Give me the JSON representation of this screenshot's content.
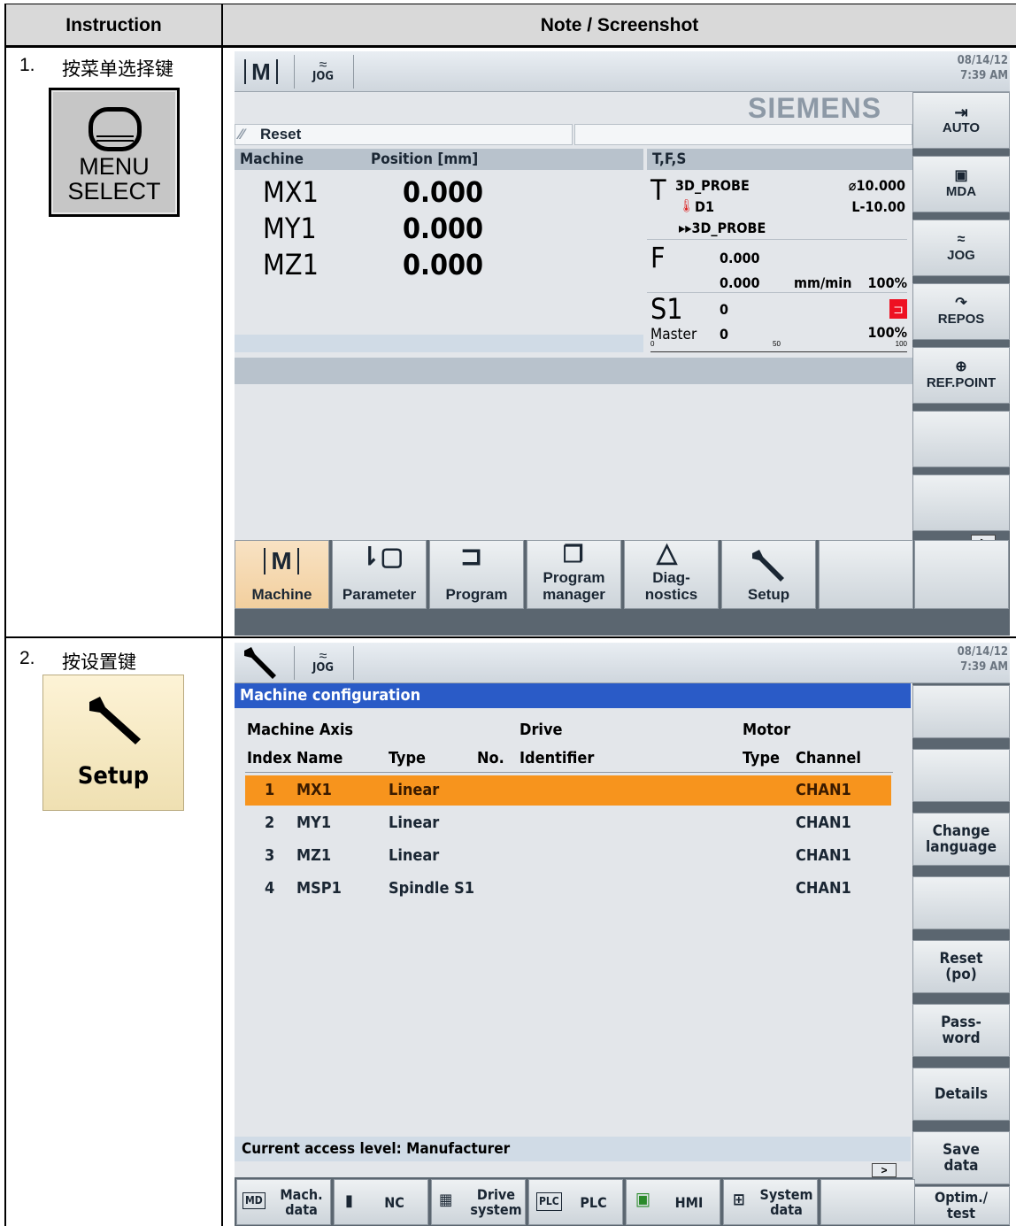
{
  "table": {
    "col1_header": "Instruction",
    "col2_header": "Note / Screenshot"
  },
  "step1": {
    "number": "1.",
    "text": "按菜单选择键",
    "key": {
      "line1": "MENU",
      "line2": "SELECT"
    },
    "screen": {
      "datetime": {
        "date": "08/14/12",
        "time": "7:39 AM"
      },
      "mode_label": "JOG",
      "brand": "SIEMENS",
      "reset_label": "Reset",
      "machine_header": "Machine",
      "position_header": "Position [mm]",
      "tfs_header": "T,F,S",
      "axes": [
        {
          "name": "MX1",
          "value": "0.000"
        },
        {
          "name": "MY1",
          "value": "0.000"
        },
        {
          "name": "MZ1",
          "value": "0.000"
        }
      ],
      "tool": {
        "letter": "T",
        "name": "3D_PROBE",
        "diameter": "⌀10.000",
        "d": "D1",
        "length": "L-10.00",
        "next": "▸▸3D_PROBE"
      },
      "feed": {
        "letter": "F",
        "actual": "0.000",
        "set": "0.000",
        "unit": "mm/min",
        "override": "100%"
      },
      "spindle": {
        "letter": "S1",
        "value": "0",
        "master_label": "Master",
        "master_value": "0",
        "override": "100%",
        "scale": [
          "0",
          "50",
          "100"
        ]
      },
      "vsoftkeys": [
        "AUTO",
        "MDA",
        "JOG",
        "REPOS",
        "REF.POINT",
        "",
        "",
        ">"
      ],
      "hsoftkeys": [
        {
          "line1": "",
          "line2": "Machine"
        },
        {
          "line1": "",
          "line2": "Parameter"
        },
        {
          "line1": "",
          "line2": "Program"
        },
        {
          "line1": "Program",
          "line2": "manager"
        },
        {
          "line1": "Diag-",
          "line2": "nostics"
        },
        {
          "line1": "",
          "line2": "Setup"
        },
        {
          "line1": "",
          "line2": ""
        }
      ]
    }
  },
  "step2": {
    "number": "2.",
    "text": "按设置键",
    "key": {
      "label": "Setup"
    },
    "screen": {
      "datetime": {
        "date": "08/14/12",
        "time": "7:39 AM"
      },
      "mode_label": "JOG",
      "title": "Machine configuration",
      "group_headers": {
        "machine_axis": "Machine Axis",
        "drive": "Drive",
        "motor": "Motor"
      },
      "col_headers": {
        "index": "Index",
        "name": "Name",
        "type": "Type",
        "no": "No.",
        "identifier": "Identifier",
        "motor_type": "Type",
        "channel": "Channel"
      },
      "rows": [
        {
          "index": "1",
          "name": "MX1",
          "type": "Linear",
          "channel": "CHAN1"
        },
        {
          "index": "2",
          "name": "MY1",
          "type": "Linear",
          "channel": "CHAN1"
        },
        {
          "index": "3",
          "name": "MZ1",
          "type": "Linear",
          "channel": "CHAN1"
        },
        {
          "index": "4",
          "name": "MSP1",
          "type": "Spindle S1",
          "channel": "CHAN1"
        }
      ],
      "access_level": "Current access level: Manufacturer",
      "vsoftkeys": [
        {
          "line1": "",
          "line2": ""
        },
        {
          "line1": "",
          "line2": ""
        },
        {
          "line1": "Change",
          "line2": "language"
        },
        {
          "line1": "",
          "line2": ""
        },
        {
          "line1": "Reset",
          "line2": "(po)"
        },
        {
          "line1": "Pass-",
          "line2": "word"
        },
        {
          "line1": "Details",
          "line2": ""
        },
        {
          "line1": "Save",
          "line2": "data"
        }
      ],
      "hsoftkeys": [
        {
          "line1": "Mach.",
          "line2": "data",
          "icon": "MD"
        },
        {
          "line1": "NC",
          "line2": "",
          "icon": "nc"
        },
        {
          "line1": "Drive",
          "line2": "system",
          "icon": "drive"
        },
        {
          "line1": "PLC",
          "line2": "",
          "icon": "PLC"
        },
        {
          "line1": "HMI",
          "line2": "",
          "icon": "hmi"
        },
        {
          "line1": "System",
          "line2": "data",
          "icon": "sys"
        },
        {
          "line1": "",
          "line2": ""
        }
      ],
      "etc_label": ">",
      "optim_line1": "Optim./",
      "optim_line2": "test"
    }
  }
}
